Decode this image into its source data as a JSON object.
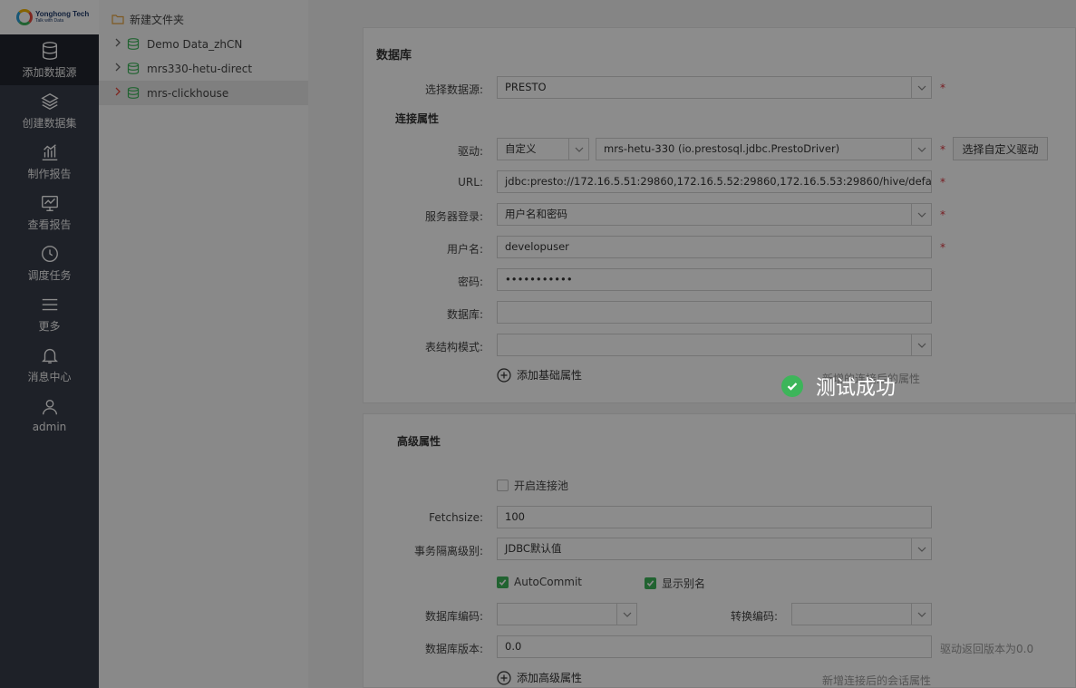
{
  "sidebar": {
    "logo": {
      "brand": "Yonghong Tech",
      "tagline": "Talk with Data"
    },
    "items": [
      {
        "label": "添加数据源",
        "icon": "database-icon",
        "active": true
      },
      {
        "label": "创建数据集",
        "icon": "layers-icon"
      },
      {
        "label": "制作报告",
        "icon": "chart-icon"
      },
      {
        "label": "查看报告",
        "icon": "monitor-chart-icon"
      },
      {
        "label": "调度任务",
        "icon": "clock-icon"
      },
      {
        "label": "更多",
        "icon": "menu-icon"
      },
      {
        "label": "消息中心",
        "icon": "bell-icon"
      },
      {
        "label": "admin",
        "icon": "user-icon"
      }
    ]
  },
  "tree": {
    "new_folder": "新建文件夹",
    "items": [
      {
        "label": "Demo Data_zhCN"
      },
      {
        "label": "mrs330-hetu-direct"
      },
      {
        "label": "mrs-clickhouse",
        "selected": true
      }
    ]
  },
  "database_panel": {
    "title": "数据库",
    "source_label": "选择数据源:",
    "source_value": "PRESTO",
    "conn_title": "连接属性",
    "driver_label": "驱动:",
    "driver_type": "自定义",
    "driver_value": "mrs-hetu-330 (io.prestosql.jdbc.PrestoDriver)",
    "custom_driver_btn": "选择自定义驱动",
    "url_label": "URL:",
    "url_value": "jdbc:presto://172.16.5.51:29860,172.16.5.52:29860,172.16.5.53:29860/hive/default?serviceD",
    "login_label": "服务器登录:",
    "login_value": "用户名和密码",
    "user_label": "用户名:",
    "user_value": "developuser",
    "pwd_label": "密码:",
    "pwd_value": "•••••••••••",
    "db_label": "数据库:",
    "db_value": "",
    "schema_label": "表结构模式:",
    "schema_value": "",
    "add_basic": "添加基础属性",
    "basic_hint": "新增的连接后的属性"
  },
  "advanced_panel": {
    "title": "高级属性",
    "pool_label": "开启连接池",
    "fetch_label": "Fetchsize:",
    "fetch_value": "100",
    "iso_label": "事务隔离级别:",
    "iso_value": "JDBC默认值",
    "autocommit_label": "AutoCommit",
    "alias_label": "显示别名",
    "db_encoding_label": "数据库编码:",
    "db_encoding_value": "",
    "convert_encoding_label": "转换编码:",
    "convert_encoding_value": "",
    "db_version_label": "数据库版本:",
    "db_version_value": "0.0",
    "version_hint": "驱动返回版本为0.0",
    "add_advanced": "添加高级属性",
    "session_hint": "新增连接后的会话属性"
  },
  "toast": {
    "message": "测试成功"
  },
  "colors": {
    "sidebar": "#373c4a",
    "success": "#3db55a",
    "required": "#d9363e"
  }
}
